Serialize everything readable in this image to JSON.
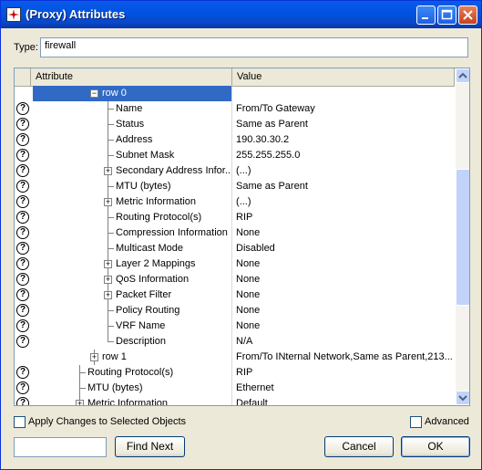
{
  "window": {
    "title": "(Proxy) Attributes"
  },
  "type_field": {
    "label": "Type:",
    "value": "firewall"
  },
  "grid": {
    "headers": {
      "attribute": "Attribute",
      "value": "Value"
    },
    "rows": [
      {
        "name": "row 0",
        "value": "",
        "depth": 1,
        "expander": "minus",
        "help": false,
        "selected": true
      },
      {
        "name": "Name",
        "value": "From/To Gateway",
        "depth": 2,
        "expander": "none",
        "help": true
      },
      {
        "name": "Status",
        "value": "Same as Parent",
        "depth": 2,
        "expander": "none",
        "help": true
      },
      {
        "name": "Address",
        "value": "190.30.30.2",
        "depth": 2,
        "expander": "none",
        "help": true
      },
      {
        "name": "Subnet Mask",
        "value": "255.255.255.0",
        "depth": 2,
        "expander": "none",
        "help": true
      },
      {
        "name": "Secondary Address Infor...",
        "value": "(...)",
        "depth": 2,
        "expander": "plus",
        "help": true
      },
      {
        "name": "MTU (bytes)",
        "value": "Same as Parent",
        "depth": 2,
        "expander": "none",
        "help": true
      },
      {
        "name": "Metric Information",
        "value": "(...)",
        "depth": 2,
        "expander": "plus",
        "help": true
      },
      {
        "name": "Routing Protocol(s)",
        "value": "RIP",
        "depth": 2,
        "expander": "none",
        "help": true
      },
      {
        "name": "Compression Information",
        "value": "None",
        "depth": 2,
        "expander": "none",
        "help": true
      },
      {
        "name": "Multicast Mode",
        "value": "Disabled",
        "depth": 2,
        "expander": "none",
        "help": true
      },
      {
        "name": "Layer 2 Mappings",
        "value": "None",
        "depth": 2,
        "expander": "plus",
        "help": true
      },
      {
        "name": "QoS Information",
        "value": "None",
        "depth": 2,
        "expander": "plus",
        "help": true
      },
      {
        "name": "Packet Filter",
        "value": "None",
        "depth": 2,
        "expander": "plus",
        "help": true
      },
      {
        "name": "Policy Routing",
        "value": "None",
        "depth": 2,
        "expander": "none",
        "help": true
      },
      {
        "name": "VRF Name",
        "value": "None",
        "depth": 2,
        "expander": "none",
        "help": true
      },
      {
        "name": "Description",
        "value": "N/A",
        "depth": 2,
        "expander": "none",
        "help": true,
        "last": true
      },
      {
        "name": "row 1",
        "value": "From/To INternal Network,Same as Parent,213....",
        "depth": 1,
        "expander": "plus",
        "help": false
      },
      {
        "name": "Routing Protocol(s)",
        "value": "RIP",
        "depth": 0,
        "expander": "none",
        "help": true
      },
      {
        "name": "MTU (bytes)",
        "value": "Ethernet",
        "depth": 0,
        "expander": "none",
        "help": true
      },
      {
        "name": "Metric Information",
        "value": "Default",
        "depth": 0,
        "expander": "plus",
        "help": true
      }
    ]
  },
  "apply_changes": {
    "label": "Apply Changes to Selected Objects",
    "checked": false
  },
  "advanced": {
    "label": "Advanced",
    "checked": false
  },
  "find": {
    "value": "",
    "button_label": "Find Next"
  },
  "buttons": {
    "cancel": "Cancel",
    "ok": "OK"
  },
  "icons": {
    "help": "question-mark-icon",
    "expand": "plus-box-icon",
    "collapse": "minus-box-icon"
  },
  "colors": {
    "title_bar": "#0054e3",
    "selection": "#316ac5",
    "face": "#ece9d8"
  }
}
